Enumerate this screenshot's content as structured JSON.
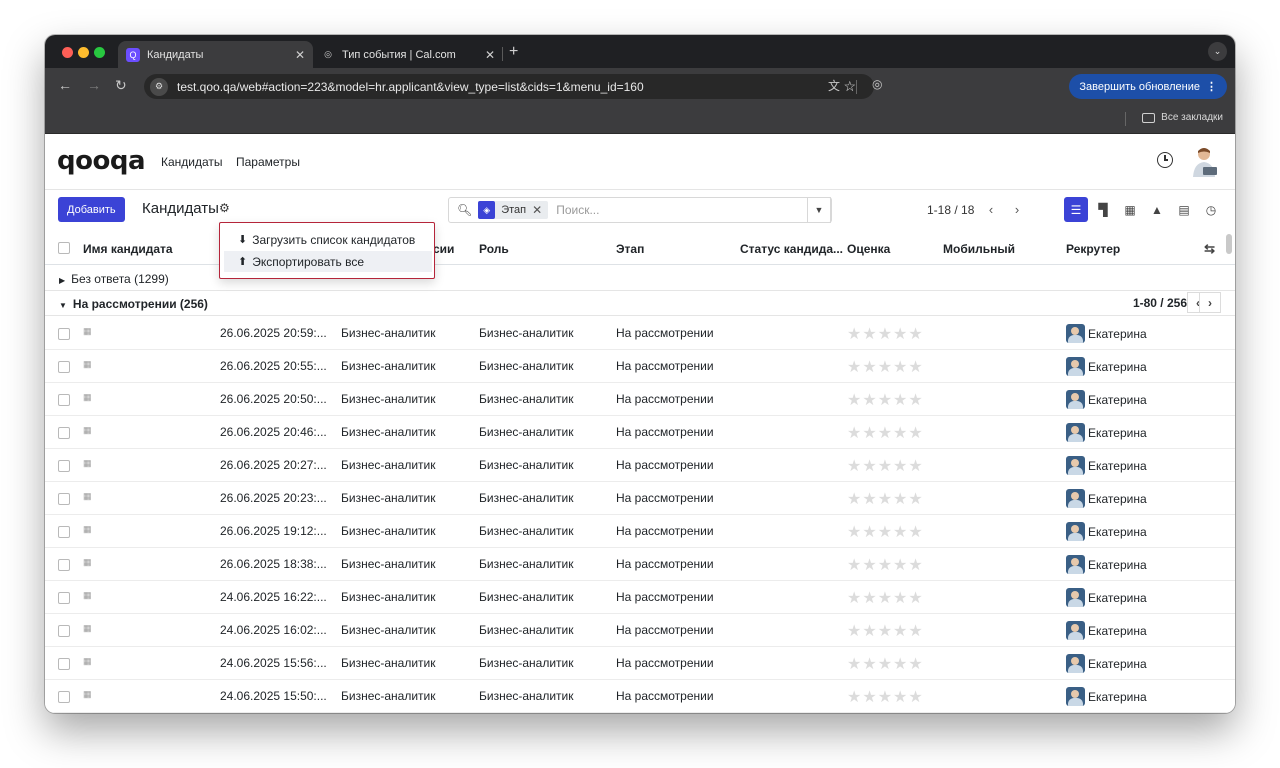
{
  "browser": {
    "tabs": [
      {
        "title": "Кандидаты",
        "active": true
      },
      {
        "title": "Тип события | Cal.com",
        "active": false
      }
    ],
    "url": "test.qoo.qa/web#action=223&model=hr.applicant&view_type=list&cids=1&menu_id=160",
    "update_button": "Завершить обновление",
    "bookmarks_all": "Все закладки"
  },
  "app": {
    "brand": "qooqa",
    "menu": [
      "Кандидаты",
      "Параметры"
    ]
  },
  "control": {
    "add_button": "Добавить",
    "breadcrumb": "Кандидаты",
    "facet_label": "Этап",
    "search_placeholder": "Поиск...",
    "pager": "1-18 / 18"
  },
  "dropdown": {
    "items": [
      "Загрузить список кандидатов",
      "Экспортировать все"
    ]
  },
  "columns": {
    "name": "Имя кандидата",
    "vacancy": "сии",
    "role": "Роль",
    "stage": "Этап",
    "status": "Статус кандида...",
    "rating": "Оценка",
    "mobile": "Мобильный",
    "recruiter": "Рекрутер"
  },
  "groups": [
    {
      "label": "Без ответа (1299)",
      "expanded": false
    },
    {
      "label": "На рассмотрении (256)",
      "expanded": true,
      "pager": "1-80 / 256"
    }
  ],
  "rows": [
    {
      "date": "26.06.2025 20:59:...",
      "vacancy": "Бизнес-аналитик",
      "role": "Бизнес-аналитик",
      "stage": "На рассмотрении",
      "recruiter": "Екатерина"
    },
    {
      "date": "26.06.2025 20:55:...",
      "vacancy": "Бизнес-аналитик",
      "role": "Бизнес-аналитик",
      "stage": "На рассмотрении",
      "recruiter": "Екатерина"
    },
    {
      "date": "26.06.2025 20:50:...",
      "vacancy": "Бизнес-аналитик",
      "role": "Бизнес-аналитик",
      "stage": "На рассмотрении",
      "recruiter": "Екатерина"
    },
    {
      "date": "26.06.2025 20:46:...",
      "vacancy": "Бизнес-аналитик",
      "role": "Бизнес-аналитик",
      "stage": "На рассмотрении",
      "recruiter": "Екатерина"
    },
    {
      "date": "26.06.2025 20:27:...",
      "vacancy": "Бизнес-аналитик",
      "role": "Бизнес-аналитик",
      "stage": "На рассмотрении",
      "recruiter": "Екатерина"
    },
    {
      "date": "26.06.2025 20:23:...",
      "vacancy": "Бизнес-аналитик",
      "role": "Бизнес-аналитик",
      "stage": "На рассмотрении",
      "recruiter": "Екатерина"
    },
    {
      "date": "26.06.2025 19:12:...",
      "vacancy": "Бизнес-аналитик",
      "role": "Бизнес-аналитик",
      "stage": "На рассмотрении",
      "recruiter": "Екатерина"
    },
    {
      "date": "26.06.2025 18:38:...",
      "vacancy": "Бизнес-аналитик",
      "role": "Бизнес-аналитик",
      "stage": "На рассмотрении",
      "recruiter": "Екатерина"
    },
    {
      "date": "24.06.2025 16:22:...",
      "vacancy": "Бизнес-аналитик",
      "role": "Бизнес-аналитик",
      "stage": "На рассмотрении",
      "recruiter": "Екатерина"
    },
    {
      "date": "24.06.2025 16:02:...",
      "vacancy": "Бизнес-аналитик",
      "role": "Бизнес-аналитик",
      "stage": "На рассмотрении",
      "recruiter": "Екатерина"
    },
    {
      "date": "24.06.2025 15:56:...",
      "vacancy": "Бизнес-аналитик",
      "role": "Бизнес-аналитик",
      "stage": "На рассмотрении",
      "recruiter": "Екатерина"
    },
    {
      "date": "24.06.2025 15:50:...",
      "vacancy": "Бизнес-аналитик",
      "role": "Бизнес-аналитик",
      "stage": "На рассмотрении",
      "recruiter": "Екатерина"
    }
  ],
  "colors": {
    "primary": "#3b43d6",
    "dropdown_border": "#b5253a",
    "update_button": "#1d4fa8"
  }
}
